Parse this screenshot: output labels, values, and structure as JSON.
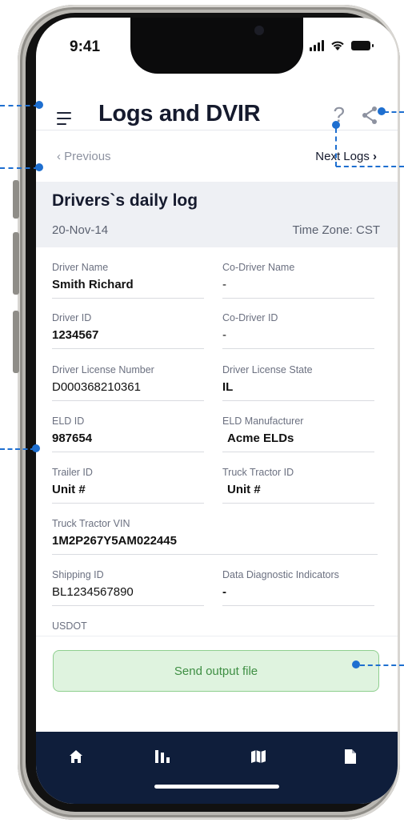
{
  "status_bar": {
    "time": "9:41"
  },
  "header": {
    "title": "Logs and DVIR",
    "help_label": "?"
  },
  "nav": {
    "previous_label": "Previous",
    "next_label": "Next Logs"
  },
  "log": {
    "title": "Drivers`s daily log",
    "date": "20-Nov-14",
    "timezone": "Time Zone: CST",
    "fields": [
      {
        "label": "Driver Name",
        "value": "Smith Richard"
      },
      {
        "label": "Co-Driver Name",
        "value": "-"
      },
      {
        "label": "Driver ID",
        "value": "1234567"
      },
      {
        "label": "Co-Driver ID",
        "value": "-"
      },
      {
        "label": "Driver License Number",
        "value": "D000368210361"
      },
      {
        "label": "Driver License State",
        "value": "IL"
      },
      {
        "label": "ELD ID",
        "value": "987654"
      },
      {
        "label": "ELD Manufacturer",
        "value": "Acme ELDs"
      },
      {
        "label": "Trailer ID",
        "value": "Unit #"
      },
      {
        "label": "Truck Tractor ID",
        "value": "Unit #"
      },
      {
        "label": "Truck Tractor VIN",
        "value": "1M2P267Y5AM022445"
      },
      {
        "label": "Shipping ID",
        "value": "BL1234567890"
      },
      {
        "label": "Data Diagnostic Indicators",
        "value": "-"
      },
      {
        "label": "USDOT",
        "value": ""
      }
    ]
  },
  "actions": {
    "send_label": "Send output file"
  },
  "tabbar": {
    "icons": [
      "home-icon",
      "bar-chart-icon",
      "map-icon",
      "document-icon"
    ]
  },
  "colors": {
    "accent": "#1e6fd0",
    "tabbar": "#0f1e3b",
    "send_bg": "#dff3df",
    "send_text": "#3f8f44"
  }
}
